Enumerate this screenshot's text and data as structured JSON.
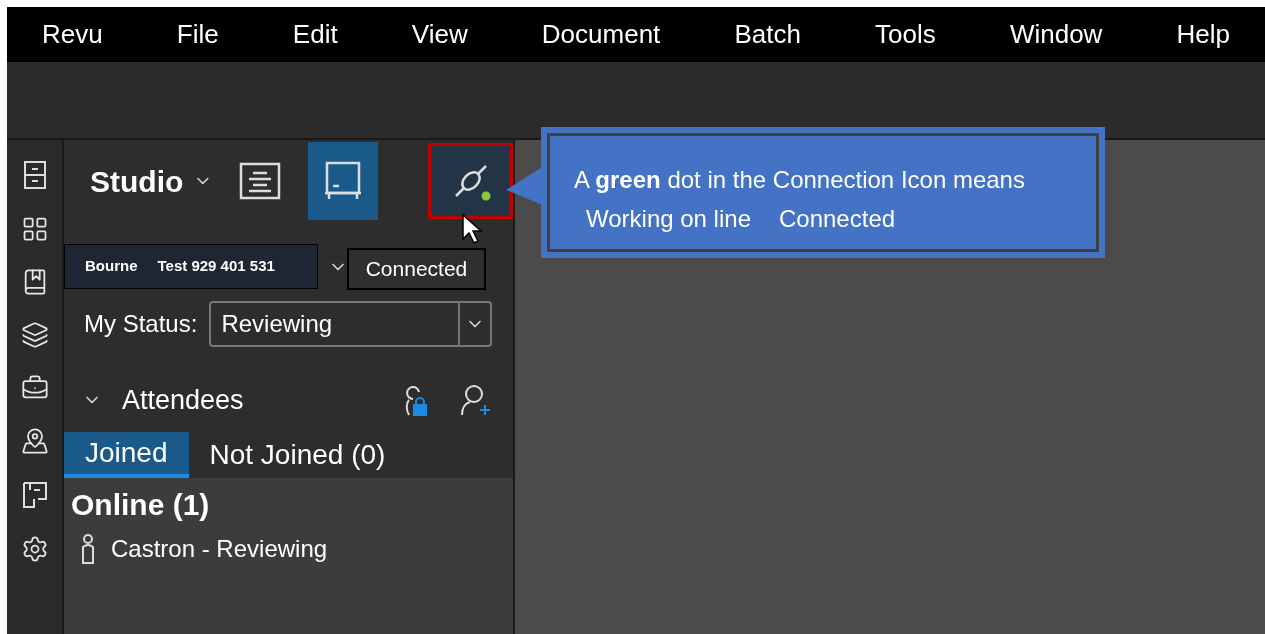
{
  "menu": [
    {
      "label": "Revu"
    },
    {
      "label": "File"
    },
    {
      "label": "Edit"
    },
    {
      "label": "View"
    },
    {
      "label": "Document"
    },
    {
      "label": "Batch"
    },
    {
      "label": "Tools"
    },
    {
      "label": "Window"
    },
    {
      "label": "Help"
    }
  ],
  "panel": {
    "title": "Studio",
    "modes": [
      {
        "kind": "sessions",
        "selected": false
      },
      {
        "kind": "board",
        "selected": true
      }
    ],
    "connection": {
      "connected": true,
      "color": "#8dc63f",
      "tooltip": "Connected"
    },
    "session": {
      "name": "Bourne",
      "id": "Test 929 401 531"
    },
    "status": {
      "label": "My Status:",
      "value": "Reviewing"
    },
    "attendees": {
      "title": "Attendees",
      "expanded": true,
      "tabs": [
        {
          "label": "Joined",
          "selected": true
        },
        {
          "label": "Not Joined (0)",
          "selected": false
        }
      ],
      "group": "Online (1)",
      "people": [
        {
          "name": "Castron - Reviewing"
        }
      ]
    }
  },
  "callout": {
    "line1": "A **green** dot in the Connection Icon means",
    "line2a": "Working on line",
    "line2b": "Connected"
  }
}
